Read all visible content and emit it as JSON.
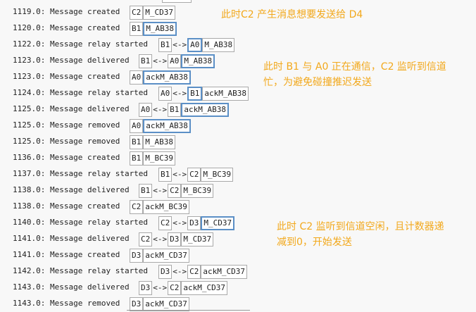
{
  "log_rows": [
    {
      "text": "1119.0: Message created",
      "cells": [
        {
          "t": "C2"
        }
      ],
      "tail": {
        "t": "M_CD37"
      },
      "tail_hl": false
    },
    {
      "text": "1120.0: Message created",
      "cells": [
        {
          "t": "B1"
        }
      ],
      "tail": {
        "t": "M_AB38"
      },
      "tail_hl": true
    },
    {
      "text": "1122.0: Message relay started",
      "cells": [
        {
          "t": "B1"
        }
      ],
      "arrow": "<->",
      "peer": {
        "t": "A0",
        "hl": true
      },
      "tail": {
        "t": "M_AB38"
      }
    },
    {
      "text": "1123.0: Message delivered",
      "cells": [
        {
          "t": "B1"
        }
      ],
      "arrow": "<->",
      "peer": {
        "t": "A0"
      },
      "tail": {
        "t": "M_AB38"
      },
      "tail_hl": true
    },
    {
      "text": "1123.0: Message created",
      "cells": [
        {
          "t": "A0"
        }
      ],
      "tail": {
        "t": "ackM_AB38"
      },
      "tail_hl": true
    },
    {
      "text": "1124.0: Message relay started",
      "cells": [
        {
          "t": "A0"
        }
      ],
      "arrow": "<->",
      "peer": {
        "t": "B1",
        "hl": true
      },
      "tail": {
        "t": "ackM_AB38"
      }
    },
    {
      "text": "1125.0: Message delivered",
      "cells": [
        {
          "t": "A0"
        }
      ],
      "arrow": "<->",
      "peer": {
        "t": "B1"
      },
      "tail": {
        "t": "ackM_AB38"
      },
      "tail_hl": true
    },
    {
      "text": "1125.0: Message removed",
      "cells": [
        {
          "t": "A0"
        }
      ],
      "tail": {
        "t": "ackM_AB38"
      },
      "tail_hl": true
    },
    {
      "text": "1125.0: Message removed",
      "cells": [
        {
          "t": "B1"
        }
      ],
      "tail": {
        "t": "M_AB38"
      }
    },
    {
      "text": "1136.0: Message created",
      "cells": [
        {
          "t": "B1"
        }
      ],
      "tail": {
        "t": "M_BC39"
      }
    },
    {
      "text": "1137.0: Message relay started",
      "cells": [
        {
          "t": "B1"
        }
      ],
      "arrow": "<->",
      "peer": {
        "t": "C2"
      },
      "tail": {
        "t": "M_BC39"
      }
    },
    {
      "text": "1138.0: Message delivered",
      "cells": [
        {
          "t": "B1"
        }
      ],
      "arrow": "<->",
      "peer": {
        "t": "C2"
      },
      "tail": {
        "t": "M_BC39"
      }
    },
    {
      "text": "1138.0: Message created",
      "cells": [
        {
          "t": "C2"
        }
      ],
      "tail": {
        "t": "ackM_BC39"
      }
    },
    {
      "text": "1140.0: Message relay started",
      "cells": [
        {
          "t": "C2"
        }
      ],
      "arrow": "<->",
      "peer": {
        "t": "D3"
      },
      "tail": {
        "t": "M_CD37"
      },
      "tail_hl": true
    },
    {
      "text": "1141.0: Message delivered",
      "cells": [
        {
          "t": "C2"
        }
      ],
      "arrow": "<->",
      "peer": {
        "t": "D3"
      },
      "tail": {
        "t": "M_CD37"
      }
    },
    {
      "text": "1141.0: Message created",
      "cells": [
        {
          "t": "D3"
        }
      ],
      "tail": {
        "t": "ackM_CD37"
      }
    },
    {
      "text": "1142.0: Message relay started",
      "cells": [
        {
          "t": "D3"
        }
      ],
      "arrow": "<->",
      "peer": {
        "t": "C2"
      },
      "tail": {
        "t": "ackM_CD37"
      }
    },
    {
      "text": "1143.0: Message delivered",
      "cells": [
        {
          "t": "D3"
        }
      ],
      "arrow": "<->",
      "peer": {
        "t": "C2"
      },
      "tail": {
        "t": "ackM_CD37"
      }
    },
    {
      "text": "1143.0: Message removed",
      "cells": [
        {
          "t": "D3"
        }
      ],
      "tail": {
        "t": "ackM_CD37"
      }
    }
  ],
  "notes": {
    "note1": "此时C2 产生消息想要发送给 D4",
    "note2_line1": "此时 B1 与 A0 正在通信，C2 监听到信道",
    "note2_line2": "忙，为避免碰撞推迟发送",
    "note3_line1": "此时 C2 监听到信道空闲，且计数器递",
    "note3_line2": "减到0，开始发送"
  },
  "colors": {
    "note": "#f2a81b",
    "highlight_border": "#5b8fc6",
    "cell_border": "#a9a9a9"
  }
}
